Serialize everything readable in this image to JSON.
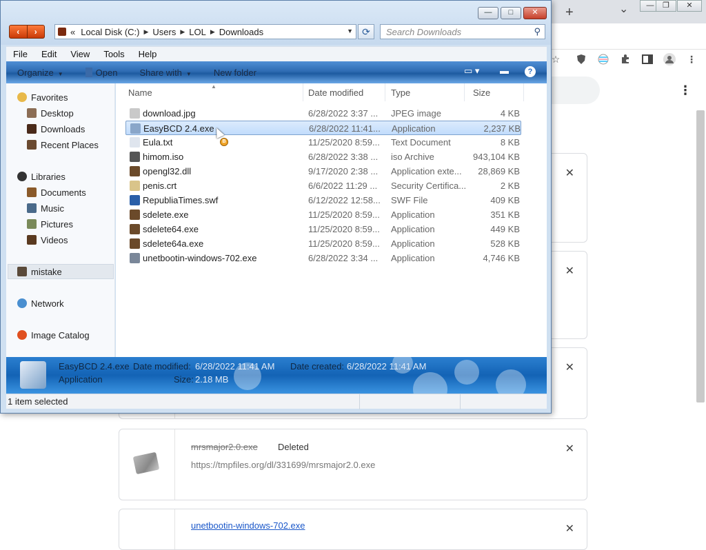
{
  "chrome": {
    "new_tab": "+",
    "tab_menu": "⌄",
    "window_controls": [
      "—",
      "❐",
      "✕"
    ],
    "kebab": "⋮",
    "downloads": [
      {
        "name": "mrsmajor2.0.exe",
        "status": "Deleted",
        "url": "https://tmpfiles.org/dl/331699/mrsmajor2.0.exe"
      },
      {
        "name": "unetbootin-windows-702.exe"
      }
    ],
    "close_glyph": "✕"
  },
  "explorer": {
    "caption_buttons": [
      "—",
      "□",
      "✕"
    ],
    "nav_buttons": [
      "‹",
      "›"
    ],
    "address": {
      "prefix": "«",
      "crumbs": [
        "Local Disk (C:)",
        "Users",
        "LOL",
        "Downloads"
      ],
      "separator": "▶"
    },
    "search": {
      "placeholder": "Search Downloads"
    },
    "menu": [
      "File",
      "Edit",
      "View",
      "Tools",
      "Help"
    ],
    "commands": {
      "organize": "Organize",
      "open": "Open",
      "share_with": "Share with",
      "new_folder": "New folder",
      "help": "?"
    },
    "nav": {
      "favorites": "Favorites",
      "desktop": "Desktop",
      "downloads": "Downloads",
      "recent_places": "Recent Places",
      "libraries": "Libraries",
      "documents": "Documents",
      "music": "Music",
      "pictures": "Pictures",
      "videos": "Videos",
      "mistake": "mistake",
      "network": "Network",
      "image_catalog": "Image Catalog"
    },
    "columns": {
      "name": "Name",
      "date": "Date modified",
      "type": "Type",
      "size": "Size"
    },
    "files": [
      {
        "name": "download.jpg",
        "date": "6/28/2022 3:37 ...",
        "type": "JPEG image",
        "size": "4 KB",
        "color": "#c9c9c9"
      },
      {
        "name": "EasyBCD 2.4.exe",
        "date": "6/28/2022 11:41...",
        "type": "Application",
        "size": "2,237 KB",
        "color": "#8aa6c9"
      },
      {
        "name": "Eula.txt",
        "date": "11/25/2020 8:59...",
        "type": "Text Document",
        "size": "8 KB",
        "color": "#dfe5ee"
      },
      {
        "name": "himom.iso",
        "date": "6/28/2022 3:38 ...",
        "type": "iso Archive",
        "size": "943,104 KB",
        "color": "#555555"
      },
      {
        "name": "opengl32.dll",
        "date": "9/17/2020 2:38 ...",
        "type": "Application exte...",
        "size": "28,869 KB",
        "color": "#6b4a2a"
      },
      {
        "name": "penis.crt",
        "date": "6/6/2022 11:29 ...",
        "type": "Security Certifica...",
        "size": "2 KB",
        "color": "#d9c48a"
      },
      {
        "name": "RepubliaTimes.swf",
        "date": "6/12/2022 12:58...",
        "type": "SWF File",
        "size": "409 KB",
        "color": "#2a5fa8"
      },
      {
        "name": "sdelete.exe",
        "date": "11/25/2020 8:59...",
        "type": "Application",
        "size": "351 KB",
        "color": "#6b4a2a"
      },
      {
        "name": "sdelete64.exe",
        "date": "11/25/2020 8:59...",
        "type": "Application",
        "size": "449 KB",
        "color": "#6b4a2a"
      },
      {
        "name": "sdelete64a.exe",
        "date": "11/25/2020 8:59...",
        "type": "Application",
        "size": "528 KB",
        "color": "#6b4a2a"
      },
      {
        "name": "unetbootin-windows-702.exe",
        "date": "6/28/2022 3:34 ...",
        "type": "Application",
        "size": "4,746 KB",
        "color": "#7a8799"
      }
    ],
    "cursor_badge": "B",
    "details": {
      "name": "EasyBCD 2.4.exe",
      "type": "Application",
      "date_modified_label": "Date modified:",
      "date_modified": "6/28/2022 11:41 AM",
      "date_created_label": "Date created:",
      "date_created": "6/28/2022 11:41 AM",
      "size_label": "Size:",
      "size": "2.18 MB"
    },
    "status": "1 item selected"
  }
}
